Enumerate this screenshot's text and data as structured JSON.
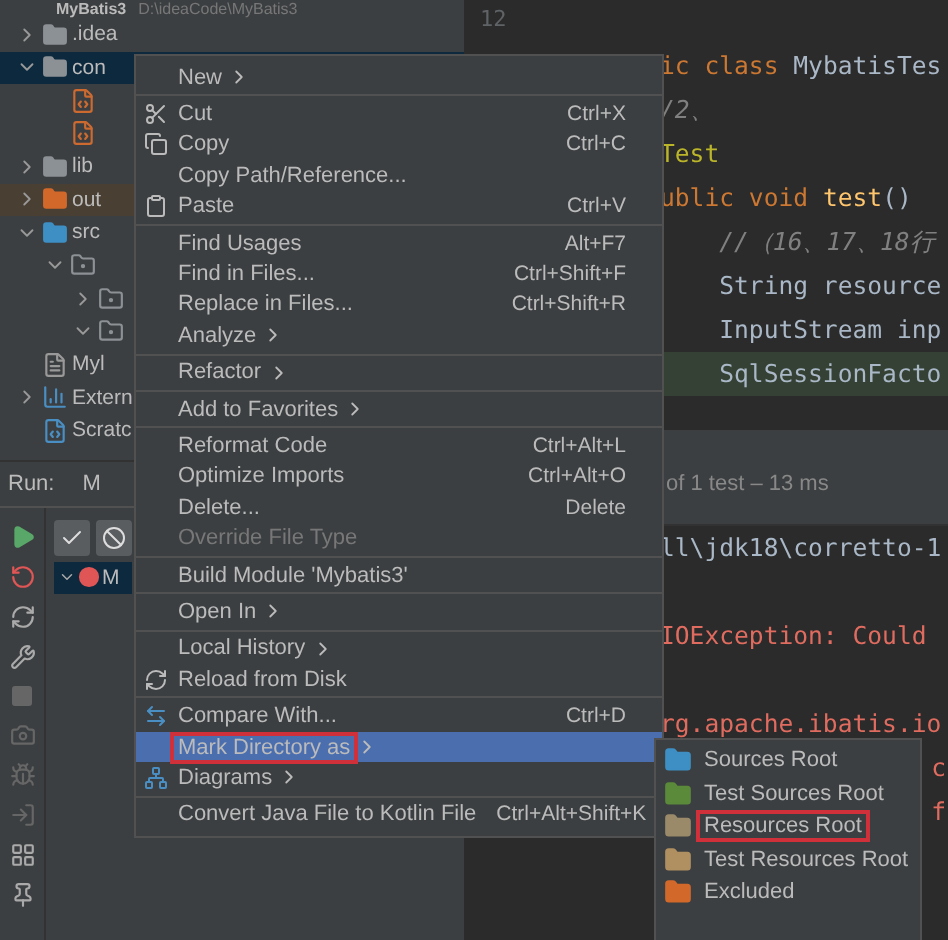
{
  "project": {
    "name": "MyBatis3",
    "path": "D:\\ideaCode\\MyBatis3"
  },
  "tree": [
    {
      "label": ".idea",
      "kind": "folder",
      "expanded": false,
      "selected": false
    },
    {
      "label": "con",
      "kind": "folder",
      "expanded": true,
      "selected": true,
      "children": [
        {
          "kind": "xml"
        },
        {
          "kind": "xml"
        }
      ]
    },
    {
      "label": "lib",
      "kind": "folder",
      "expanded": false,
      "selected": false
    },
    {
      "label": "out",
      "kind": "excluded",
      "expanded": false,
      "selected": false
    },
    {
      "label": "src",
      "kind": "source",
      "expanded": true,
      "selected": false,
      "children": [
        {
          "kind": "package",
          "expanded": true,
          "children": [
            {
              "kind": "package",
              "expanded": false
            },
            {
              "kind": "package",
              "expanded": true
            }
          ]
        }
      ]
    },
    {
      "label": "Myl",
      "kind": "module",
      "selected": false
    },
    {
      "label": "Extern",
      "kind": "library",
      "expanded": false,
      "selected": false
    },
    {
      "label": "Scratc",
      "kind": "scratch",
      "selected": false
    }
  ],
  "run": {
    "label": "Run:",
    "tab": "M",
    "item": "M"
  },
  "editor": {
    "line_number": "12",
    "lines": [
      [
        {
          "text": "ic class",
          "kind": "keyword"
        },
        {
          "text": " MybatisTes",
          "kind": "plain"
        }
      ],
      [
        {
          "text": "/2、",
          "kind": "comment"
        }
      ],
      [
        {
          "text": "Test",
          "kind": "annotation"
        }
      ],
      [
        {
          "text": "ublic void",
          "kind": "keyword"
        },
        {
          "text": " test",
          "kind": "method"
        },
        {
          "text": "()",
          "kind": "plain"
        }
      ],
      [
        {
          "text": "    //（16、17、18行",
          "kind": "comment"
        }
      ],
      [
        {
          "text": "    String resource",
          "kind": "plain"
        }
      ],
      [
        {
          "text": "    InputStream inp",
          "kind": "plain"
        }
      ],
      [
        {
          "text": "    SqlSessionFacto",
          "kind": "plain",
          "highlight": true
        }
      ]
    ]
  },
  "run_output": {
    "status": "of 1 test – 13 ms",
    "lines": [
      {
        "text": "ll\\jdk18\\corretto-1",
        "kind": "plain"
      },
      {
        "kind": "blank"
      },
      {
        "text": "IOException: Could",
        "kind": "error"
      },
      {
        "kind": "blank"
      },
      {
        "text": "rg.apache.ibatis.io",
        "kind": "error"
      },
      {
        "text": "c",
        "kind": "edge"
      },
      {
        "text": "f",
        "kind": "edge"
      }
    ]
  },
  "menu": [
    [
      {
        "label": "New",
        "submenu": true
      }
    ],
    [
      {
        "label": "Cut",
        "shortcut": "Ctrl+X",
        "kind": "cut"
      },
      {
        "label": "Copy",
        "shortcut": "Ctrl+C",
        "kind": "copy"
      },
      {
        "label": "Copy Path/Reference..."
      },
      {
        "label": "Paste",
        "shortcut": "Ctrl+V",
        "kind": "paste"
      }
    ],
    [
      {
        "label": "Find Usages",
        "shortcut": "Alt+F7"
      },
      {
        "label": "Find in Files...",
        "shortcut": "Ctrl+Shift+F"
      },
      {
        "label": "Replace in Files...",
        "shortcut": "Ctrl+Shift+R"
      },
      {
        "label": "Analyze",
        "submenu": true
      }
    ],
    [
      {
        "label": "Refactor",
        "submenu": true
      }
    ],
    [
      {
        "label": "Add to Favorites",
        "submenu": true
      }
    ],
    [
      {
        "label": "Reformat Code",
        "shortcut": "Ctrl+Alt+L"
      },
      {
        "label": "Optimize Imports",
        "shortcut": "Ctrl+Alt+O"
      },
      {
        "label": "Delete...",
        "shortcut": "Delete"
      },
      {
        "label": "Override File Type",
        "disabled": true
      }
    ],
    [
      {
        "label": "Build Module 'Mybatis3'"
      }
    ],
    [
      {
        "label": "Open In",
        "submenu": true
      }
    ],
    [
      {
        "label": "Local History",
        "submenu": true
      },
      {
        "label": "Reload from Disk",
        "kind": "reload"
      }
    ],
    [
      {
        "label": "Compare With...",
        "shortcut": "Ctrl+D",
        "kind": "compare"
      },
      {
        "label": "Mark Directory as",
        "submenu": true,
        "selected": true,
        "outlined": true
      },
      {
        "label": "Diagrams",
        "submenu": true,
        "kind": "diagram"
      }
    ],
    [
      {
        "label": "Convert Java File to Kotlin File",
        "shortcut": "Ctrl+Alt+Shift+K"
      }
    ]
  ],
  "submenu": [
    {
      "label": "Sources Root",
      "color": "#3d8fc4",
      "outlined": false
    },
    {
      "label": "Test Sources Root",
      "color": "#5a8a3a",
      "outlined": false
    },
    {
      "label": "Resources Root",
      "color": "#9a8a6a",
      "outlined": true
    },
    {
      "label": "Test Resources Root",
      "color": "#b09060",
      "outlined": false
    },
    {
      "label": "Excluded",
      "color": "#d2692b",
      "outlined": false
    }
  ]
}
